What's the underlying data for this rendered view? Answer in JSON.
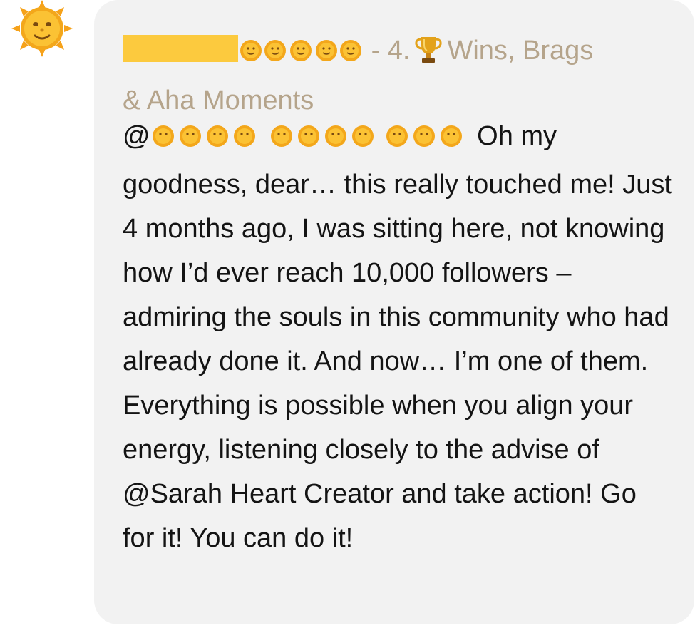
{
  "comment": {
    "header": {
      "separator": "-",
      "category_number": "4.",
      "category_icon": "trophy-icon",
      "category_label": "Wins, Brags",
      "category_label_line2": "& Aha Moments"
    },
    "body": {
      "mention_prefix": "@",
      "text_after_mention": " Oh my goodness, dear… this really touched me! Just 4 months ago, I was sitting here, not knowing how I’d ever reach 10,000 followers – admiring the souls in this community who had already done it. And now… I’m one of them. Everything is possible when you align your energy, listening closely to the advise of @Sarah Heart Creator and take action! Go for it! You can do it!"
    },
    "avatar_icon": "sun-face-icon",
    "colors": {
      "bubble": "#f2f2f2",
      "header_text": "#b5a48b",
      "body_text": "#141414",
      "redaction": "#fcca3e"
    }
  }
}
